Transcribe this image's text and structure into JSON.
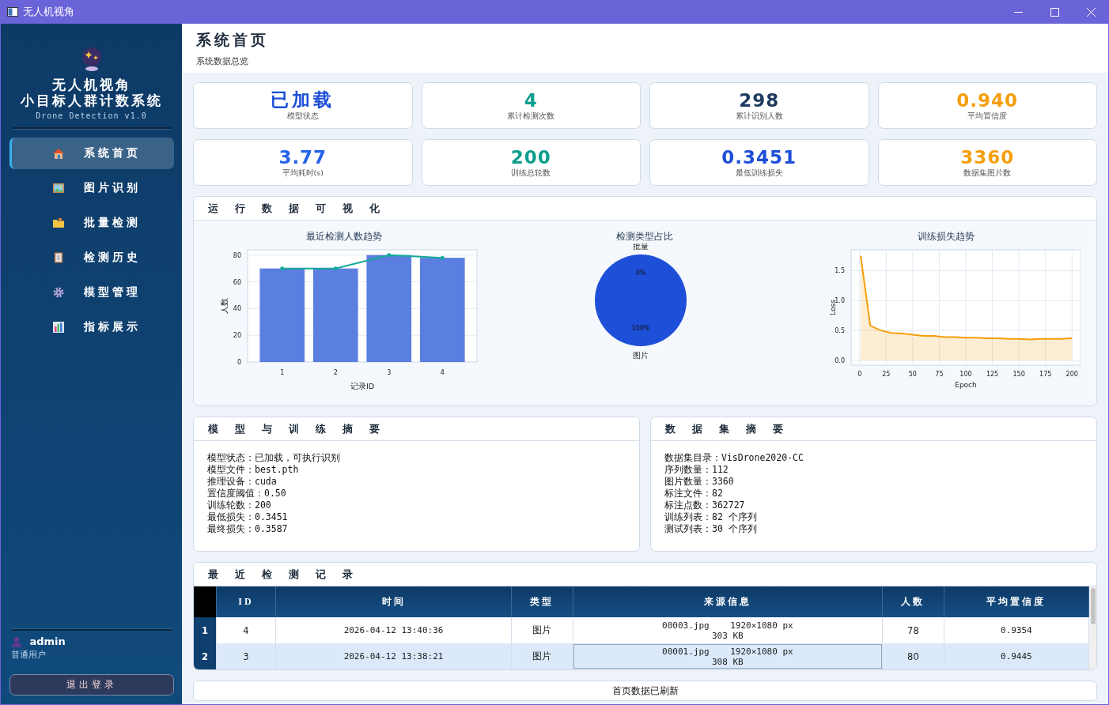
{
  "window": {
    "title": "无人机视角"
  },
  "sidebar": {
    "title_lines": [
      "无人机视角",
      "小目标人群计数系统"
    ],
    "subtitle": "Drone Detection v1.0",
    "items": [
      {
        "label": "系统首页",
        "selected": true
      },
      {
        "label": "图片识别",
        "selected": false
      },
      {
        "label": "批量检测",
        "selected": false
      },
      {
        "label": "检测历史",
        "selected": false
      },
      {
        "label": "模型管理",
        "selected": false
      },
      {
        "label": "指标展示",
        "selected": false
      }
    ],
    "user": {
      "name": "admin",
      "role": "普通用户"
    },
    "logout": "退出登录"
  },
  "header": {
    "title": "系统首页",
    "subtitle": "系统数据总览"
  },
  "stats": [
    {
      "value": "已加载",
      "label": "模型状态",
      "color": "#1d4ed8"
    },
    {
      "value": "4",
      "label": "累计检测次数",
      "color": "#0d9e8c"
    },
    {
      "value": "298",
      "label": "累计识别人数",
      "color": "#1e3a5f"
    },
    {
      "value": "0.940",
      "label": "平均置信度",
      "color": "#f59e0b"
    },
    {
      "value": "3.77",
      "label": "平均耗时(s)",
      "color": "#2563eb"
    },
    {
      "value": "200",
      "label": "训练总轮数",
      "color": "#0d9e8c"
    },
    {
      "value": "0.3451",
      "label": "最低训练损失",
      "color": "#1d4ed8"
    },
    {
      "value": "3360",
      "label": "数据集图片数",
      "color": "#f59e0b"
    }
  ],
  "visualization": {
    "title": "运行数据可视化",
    "charts": [
      {
        "chart_data": {
          "type": "bar",
          "title": "最近检测人数趋势",
          "xlabel": "记录ID",
          "ylabel": "人数",
          "categories": [
            "1",
            "2",
            "3",
            "4"
          ],
          "ylim": [
            0,
            84
          ],
          "yticks": [
            0,
            20,
            40,
            60,
            80
          ],
          "grid": true,
          "series": [
            {
              "type": "bar",
              "color": "#5b7fe0",
              "values": [
                70,
                70,
                80,
                78
              ]
            },
            {
              "type": "line",
              "color": "#14a89a",
              "values": [
                70,
                70,
                80,
                78
              ]
            }
          ]
        }
      },
      {
        "chart_data": {
          "type": "pie",
          "title": "检测类型占比",
          "categories": [
            "批量",
            "图片"
          ],
          "values": [
            0,
            100
          ],
          "value_labels": [
            "0%",
            "100%"
          ]
        }
      },
      {
        "chart_data": {
          "type": "area",
          "title": "训练损失趋势",
          "xlabel": "Epoch",
          "ylabel": "Loss",
          "xlim": [
            -8,
            208
          ],
          "ylim": [
            -0.08,
            1.85
          ],
          "xticks": [
            0,
            25,
            50,
            75,
            100,
            125,
            150,
            175,
            200
          ],
          "yticks": [
            {
              "value": 0,
              "label": "0.0"
            },
            {
              "value": 0.5,
              "label": "0.5"
            },
            {
              "value": 1,
              "label": "1.0"
            },
            {
              "value": 1.5,
              "label": "1.5"
            }
          ],
          "grid": true,
          "x": [
            1,
            10,
            20,
            30,
            40,
            50,
            60,
            70,
            80,
            90,
            100,
            110,
            120,
            130,
            140,
            150,
            160,
            170,
            180,
            190,
            200
          ],
          "series": [
            {
              "color": "#f59e0b",
              "values": [
                1.75,
                0.58,
                0.5,
                0.46,
                0.45,
                0.43,
                0.41,
                0.41,
                0.39,
                0.39,
                0.38,
                0.38,
                0.37,
                0.37,
                0.36,
                0.36,
                0.35,
                0.36,
                0.36,
                0.36,
                0.37
              ]
            }
          ]
        }
      }
    ]
  },
  "model_summary": {
    "title": "模型与训练摘要",
    "lines": [
      "模型状态：已加载，可执行识别",
      "模型文件：best.pth",
      "推理设备：cuda",
      "置信度阈值：0.50",
      "训练轮数：200",
      "最低损失：0.3451",
      "最终损失：0.3587"
    ]
  },
  "dataset_summary": {
    "title": "数据集摘要",
    "lines": [
      "数据集目录：VisDrone2020-CC",
      "序列数量：112",
      "图片数量：3360",
      "标注文件：82",
      "标注点数：362727",
      "训练列表：82 个序列",
      "测试列表：30 个序列"
    ]
  },
  "records": {
    "title": "最近检测记录",
    "columns": [
      "ID",
      "时间",
      "类型",
      "来源信息",
      "人数",
      "平均置信度"
    ],
    "rows": [
      {
        "number": "1",
        "selected": false,
        "cells": [
          "4",
          "2026-04-12 13:40:36",
          "图片",
          "00003.jpg    1920×1080 px\n303 KB",
          "78",
          "0.9354"
        ]
      },
      {
        "number": "2",
        "selected": true,
        "cells": [
          "3",
          "2026-04-12 13:38:21",
          "图片",
          "00001.jpg    1920×1080 px\n308 KB",
          "80",
          "0.9445"
        ]
      }
    ]
  },
  "status_bar": "首页数据已刷新"
}
